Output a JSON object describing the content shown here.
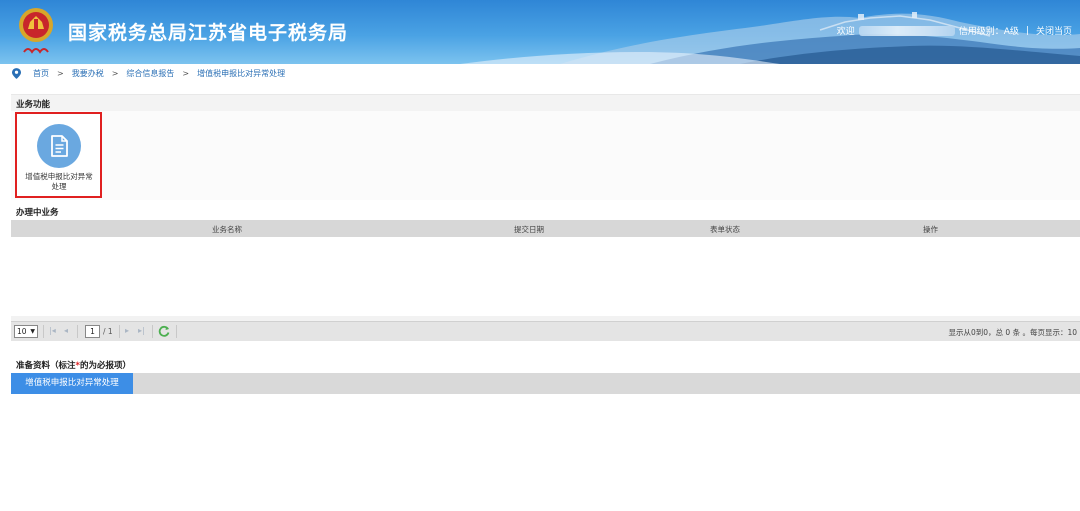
{
  "header": {
    "title": "国家税务总局江苏省电子税务局",
    "welcome": "欢迎",
    "credit_level": "信用级别：A级",
    "separator": "|",
    "close_page": "关闭当页",
    "colors": {
      "banner": "#2f86d6",
      "title": "#ffffff"
    }
  },
  "breadcrumb": {
    "icon": "location-pin-icon",
    "items": [
      "首页",
      "我要办税",
      "综合信息报告",
      "增值税申报比对异常处理"
    ],
    "separator": ">"
  },
  "business": {
    "section_title": "业务功能",
    "functions": [
      {
        "label": "增值税申报比对异常处理",
        "icon": "document-icon"
      }
    ],
    "highlight_color": "#e02020"
  },
  "in_progress": {
    "section_title": "办理中业务",
    "columns": [
      "业务名称",
      "提交日期",
      "表单状态",
      "操作"
    ],
    "rows": []
  },
  "pager": {
    "page_size": "10",
    "current_page": "1",
    "total_pages": "/ 1",
    "summary": "显示从0到0，总 0 条 。每页显示：10"
  },
  "prep": {
    "section_title_prefix": "准备资料（标注",
    "required_mark": "*",
    "section_title_suffix": "的为必报项）",
    "tabs": [
      "增值税申报比对异常处理"
    ],
    "active_tab_color": "#3d8ee6"
  }
}
